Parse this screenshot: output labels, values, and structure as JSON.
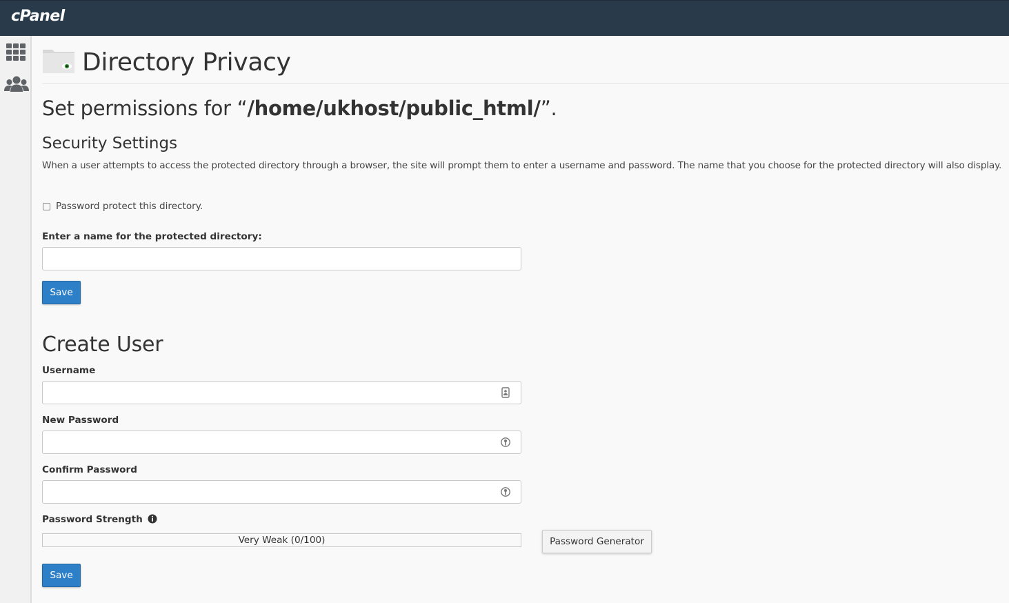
{
  "app": {
    "logo_text": "cPanel"
  },
  "sidebar": {
    "items": [
      {
        "name": "tools-grid-icon"
      },
      {
        "name": "users-icon"
      }
    ]
  },
  "page": {
    "title": "Directory Privacy",
    "permissions_prefix": "Set permissions for “",
    "directory_path": "/home/ukhost/public_html/",
    "permissions_suffix": "”."
  },
  "security": {
    "heading": "Security Settings",
    "description": "When a user attempts to access the protected directory through a browser, the site will prompt them to enter a username and password. The name that you choose for the protected directory will also display.",
    "protect_checkbox_label": "Password protect this directory.",
    "protect_checked": false,
    "dir_name_label": "Enter a name for the protected directory:",
    "dir_name_value": "",
    "save_label": "Save"
  },
  "create_user": {
    "heading": "Create User",
    "username_label": "Username",
    "username_value": "",
    "new_password_label": "New Password",
    "new_password_value": "",
    "confirm_password_label": "Confirm Password",
    "confirm_password_value": "",
    "strength_label": "Password Strength",
    "strength_text": "Very Weak (0/100)",
    "strength_score": 0,
    "generator_label": "Password Generator",
    "save_label": "Save"
  },
  "colors": {
    "topbar": "#293a4a",
    "primary_button": "#2d7fc7"
  }
}
